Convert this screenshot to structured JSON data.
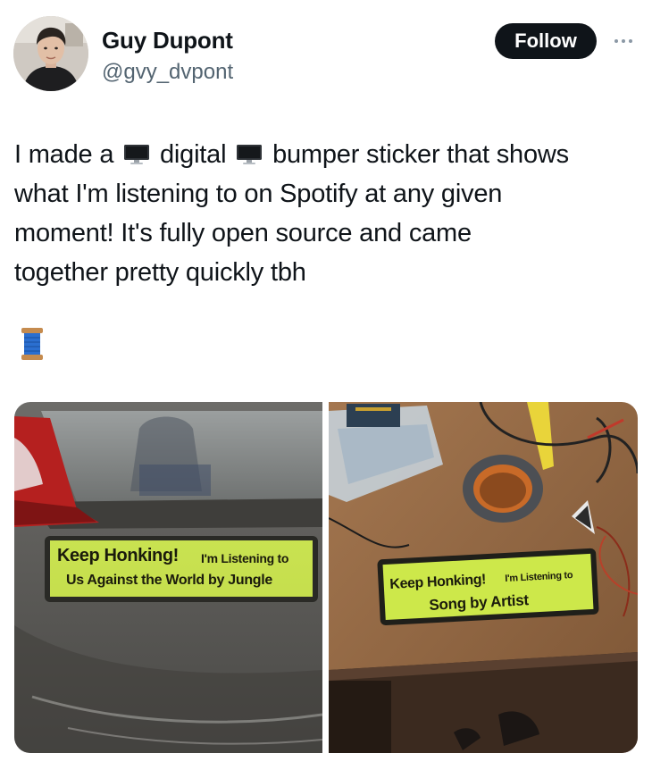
{
  "author": {
    "name": "Guy Dupont",
    "handle": "@gvy_dvpont"
  },
  "actions": {
    "follow_label": "Follow",
    "more_icon": "more-horizontal-icon"
  },
  "post": {
    "lines": [
      [
        "I made a",
        "digital",
        "bumper sticker that shows"
      ],
      "what I'm listening to on Spotify at any given",
      "moment! It's fully open source and came",
      "together pretty quickly tbh"
    ],
    "emojis": [
      "desktop-computer-icon",
      "desktop-computer-icon",
      "spool-of-thread-icon"
    ]
  },
  "media": {
    "left_photo": {
      "headline": "Keep Honking!",
      "subline": "I'm Listening to",
      "now_playing": "Us Against the World by Jungle"
    },
    "right_photo": {
      "headline": "Keep Honking!",
      "subline": "I'm Listening to",
      "now_playing": "Song by Artist"
    }
  },
  "colors": {
    "sticker_screen": "#cde84a",
    "follow_button": "#0f1419",
    "handle_text": "#536471"
  }
}
